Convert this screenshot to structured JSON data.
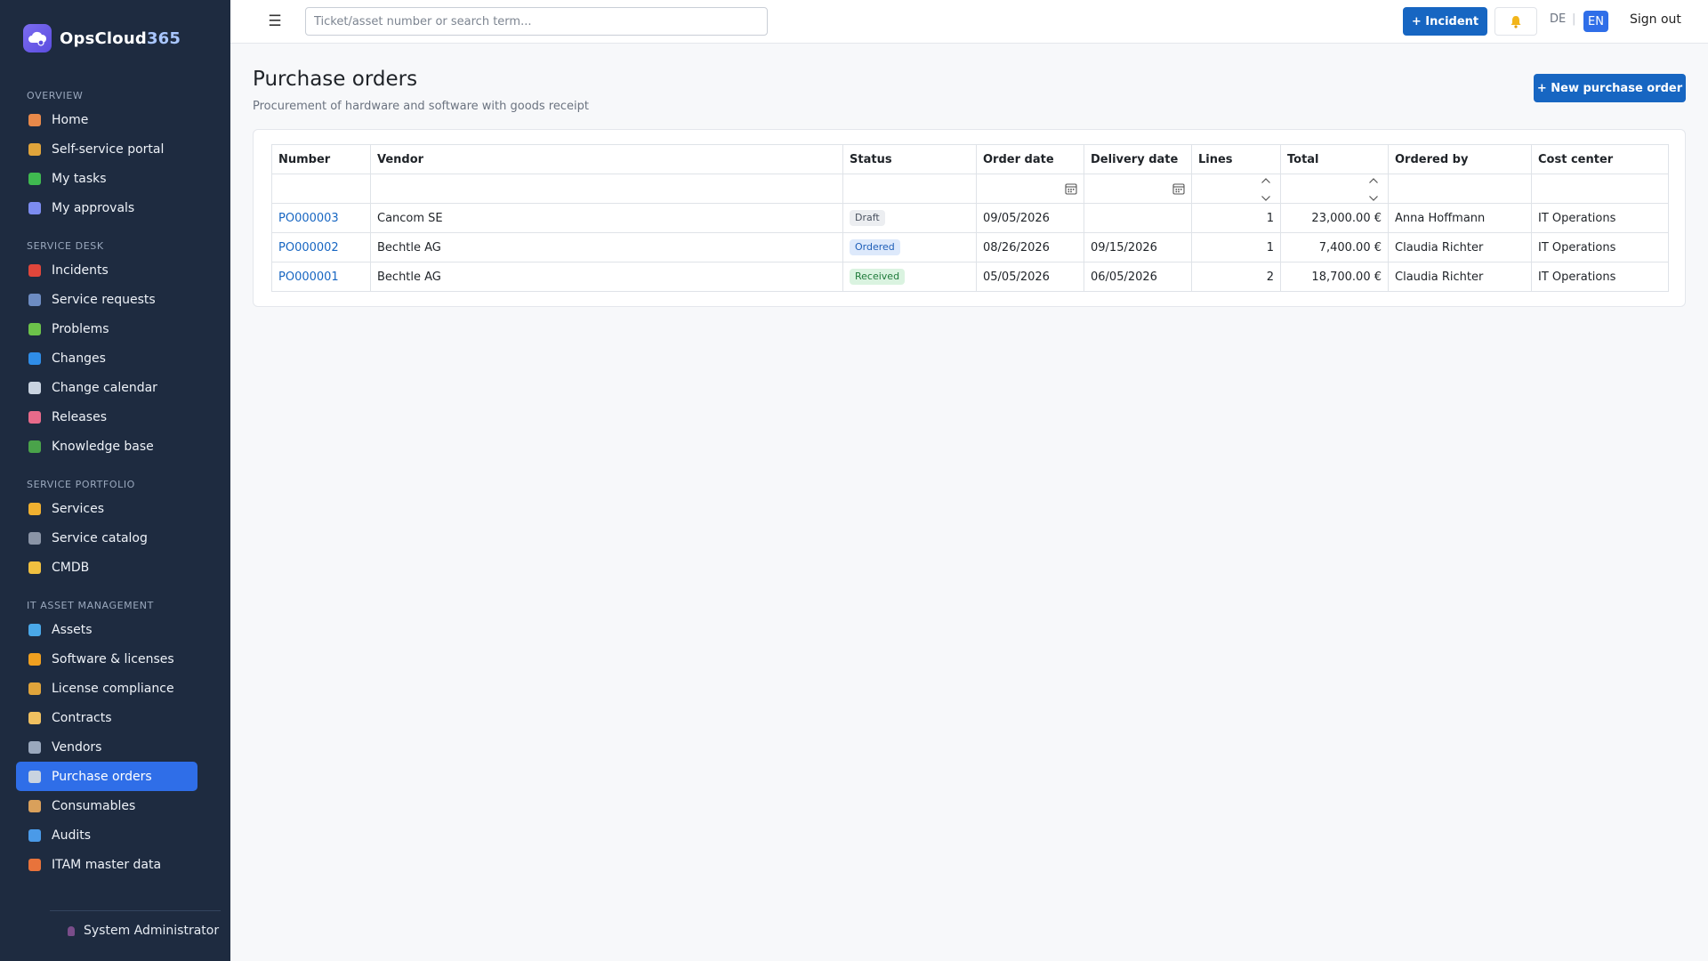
{
  "app": {
    "name_main": "OpsCloud",
    "name_accent": "365"
  },
  "sidebar": {
    "sections": [
      {
        "title": "OVERVIEW",
        "items": [
          {
            "label": "Home",
            "icon": "home-icon",
            "color": "#e8894a"
          },
          {
            "label": "Self-service portal",
            "icon": "person-icon",
            "color": "#e0a43b"
          },
          {
            "label": "My tasks",
            "icon": "checkbox-icon",
            "color": "#3fb950"
          },
          {
            "label": "My approvals",
            "icon": "checkmark-icon",
            "color": "#7c8cf0"
          }
        ]
      },
      {
        "title": "SERVICE DESK",
        "items": [
          {
            "label": "Incidents",
            "icon": "siren-icon",
            "color": "#e0463b"
          },
          {
            "label": "Service requests",
            "icon": "inbox-icon",
            "color": "#6d8cc2"
          },
          {
            "label": "Problems",
            "icon": "puzzle-icon",
            "color": "#6cc24a"
          },
          {
            "label": "Changes",
            "icon": "refresh-icon",
            "color": "#2f8de8"
          },
          {
            "label": "Change calendar",
            "icon": "calendar-icon",
            "color": "#c9d3e0"
          },
          {
            "label": "Releases",
            "icon": "rocket-icon",
            "color": "#e86a8a"
          },
          {
            "label": "Knowledge base",
            "icon": "books-icon",
            "color": "#4aa34a"
          }
        ]
      },
      {
        "title": "SERVICE PORTFOLIO",
        "items": [
          {
            "label": "Services",
            "icon": "bell-service-icon",
            "color": "#f0b030"
          },
          {
            "label": "Service catalog",
            "icon": "catalog-icon",
            "color": "#8a94a6"
          },
          {
            "label": "CMDB",
            "icon": "folder-icon",
            "color": "#f0c040"
          }
        ]
      },
      {
        "title": "IT ASSET MANAGEMENT",
        "items": [
          {
            "label": "Assets",
            "icon": "laptop-icon",
            "color": "#4aa8e8"
          },
          {
            "label": "Software & licenses",
            "icon": "disc-icon",
            "color": "#f0a020"
          },
          {
            "label": "License compliance",
            "icon": "scales-icon",
            "color": "#e0a43b"
          },
          {
            "label": "Contracts",
            "icon": "document-icon",
            "color": "#f0c060"
          },
          {
            "label": "Vendors",
            "icon": "building-icon",
            "color": "#9aa8bd"
          },
          {
            "label": "Purchase orders",
            "icon": "receipt-icon",
            "color": "#c9d3e0",
            "active": true
          },
          {
            "label": "Consumables",
            "icon": "package-icon",
            "color": "#d9a05b"
          },
          {
            "label": "Audits",
            "icon": "magnifier-icon",
            "color": "#4a9ae8"
          },
          {
            "label": "ITAM master data",
            "icon": "bricks-icon",
            "color": "#e8733b"
          }
        ]
      }
    ],
    "user": "System Administrator"
  },
  "topbar": {
    "search_placeholder": "Ticket/asset number or search term...",
    "incident_label": "+ Incident",
    "lang_de": "DE",
    "lang_sep": "|",
    "lang_en": "EN",
    "signout_label": "Sign out"
  },
  "page": {
    "title": "Purchase orders",
    "subtitle": "Procurement of hardware and software with goods receipt",
    "new_button": "+ New purchase order"
  },
  "table": {
    "columns": [
      "Number",
      "Vendor",
      "Status",
      "Order date",
      "Delivery date",
      "Lines",
      "Total",
      "Ordered by",
      "Cost center"
    ],
    "rows": [
      {
        "number": "PO000003",
        "vendor": "Cancom SE",
        "status": "Draft",
        "order_date": "09/05/2026",
        "delivery_date": "",
        "lines": "1",
        "total": "23,000.00 €",
        "ordered_by": "Anna Hoffmann",
        "cost_center": "IT Operations"
      },
      {
        "number": "PO000002",
        "vendor": "Bechtle AG",
        "status": "Ordered",
        "order_date": "08/26/2026",
        "delivery_date": "09/15/2026",
        "lines": "1",
        "total": "7,400.00 €",
        "ordered_by": "Claudia Richter",
        "cost_center": "IT Operations"
      },
      {
        "number": "PO000001",
        "vendor": "Bechtle AG",
        "status": "Received",
        "order_date": "05/05/2026",
        "delivery_date": "06/05/2026",
        "lines": "2",
        "total": "18,700.00 €",
        "ordered_by": "Claudia Richter",
        "cost_center": "IT Operations"
      }
    ],
    "status_colors": {
      "Draft": {
        "bg": "#eceef1",
        "fg": "#4a5260"
      },
      "Ordered": {
        "bg": "#dde9fb",
        "fg": "#1f5fb8"
      },
      "Received": {
        "bg": "#daf3e0",
        "fg": "#1f7a3a"
      }
    }
  },
  "colors": {
    "accent": "#1766c2",
    "sidebar_bg": "#1e2b40",
    "active_nav": "#2f6ee8"
  }
}
